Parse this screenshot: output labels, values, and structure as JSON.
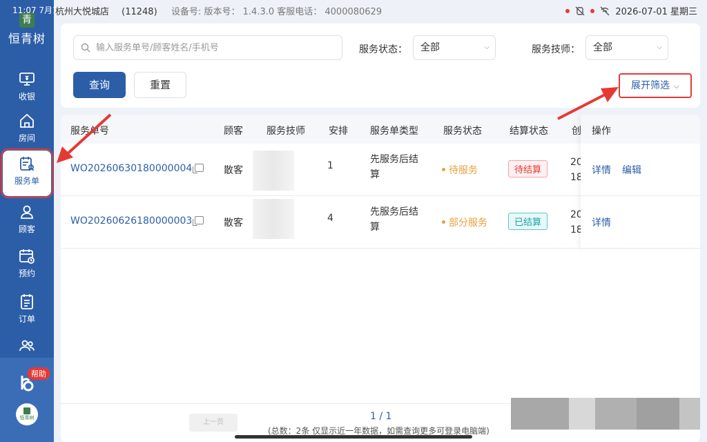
{
  "status_bar": {
    "time": "11:07",
    "date_short": "7月1",
    "store": "杭州大悦城店",
    "store_code": "(11248)",
    "device_info": "设备号:  版本号：  1.4.3.0  客服电话：  4000080629",
    "datetime": "2026-07-01  星期三"
  },
  "sidebar": {
    "brand": "恒青树",
    "items": [
      {
        "label": "收银",
        "icon": "cashier-icon"
      },
      {
        "label": "房间",
        "icon": "home-icon"
      },
      {
        "label": "服务单",
        "icon": "service-order-icon"
      },
      {
        "label": "顾客",
        "icon": "customer-icon"
      },
      {
        "label": "预约",
        "icon": "calendar-icon"
      },
      {
        "label": "订单",
        "icon": "order-icon"
      },
      {
        "label": "",
        "icon": "staff-icon"
      }
    ],
    "help_badge": "帮助",
    "footer_brand": "恒青树"
  },
  "filters": {
    "search_placeholder": "输入服务单号/顾客姓名/手机号",
    "status_label": "服务状态：",
    "status_value": "全部",
    "tech_label": "服务技师：",
    "tech_value": "全部",
    "query_label": "查询",
    "reset_label": "重置",
    "expand_label": "展开筛选"
  },
  "table": {
    "headers": [
      "服务单号",
      "顾客",
      "服务技师",
      "安排",
      "服务单类型",
      "服务状态",
      "结算状态",
      "创",
      "操作"
    ],
    "rows": [
      {
        "order_no": "WO20260630180000004",
        "customer": "散客",
        "arrange": "1",
        "type_line1": "先服务后结",
        "type_line2": "算",
        "status": "待服务",
        "settle": "待结算",
        "created_line1": "20",
        "created_line2": "18",
        "ops": [
          "详情",
          "编辑"
        ]
      },
      {
        "order_no": "WO20260626180000003",
        "customer": "散客",
        "arrange": "4",
        "type_line1": "先服务后结",
        "type_line2": "算",
        "status": "部分服务",
        "settle": "已结算",
        "created_line1": "20",
        "created_line2": "18",
        "ops": [
          "详情"
        ]
      }
    ]
  },
  "pagination": {
    "prev_label": "上一页",
    "page": "1 / 1",
    "summary": "(总数：2条 仅显示近一年数据，如需查询更多可登录电脑端)"
  },
  "colors": {
    "primary": "#2c5ea8",
    "highlight_red": "#e53935",
    "pending": "#e6a23c",
    "paid": "#1aa3a3"
  }
}
